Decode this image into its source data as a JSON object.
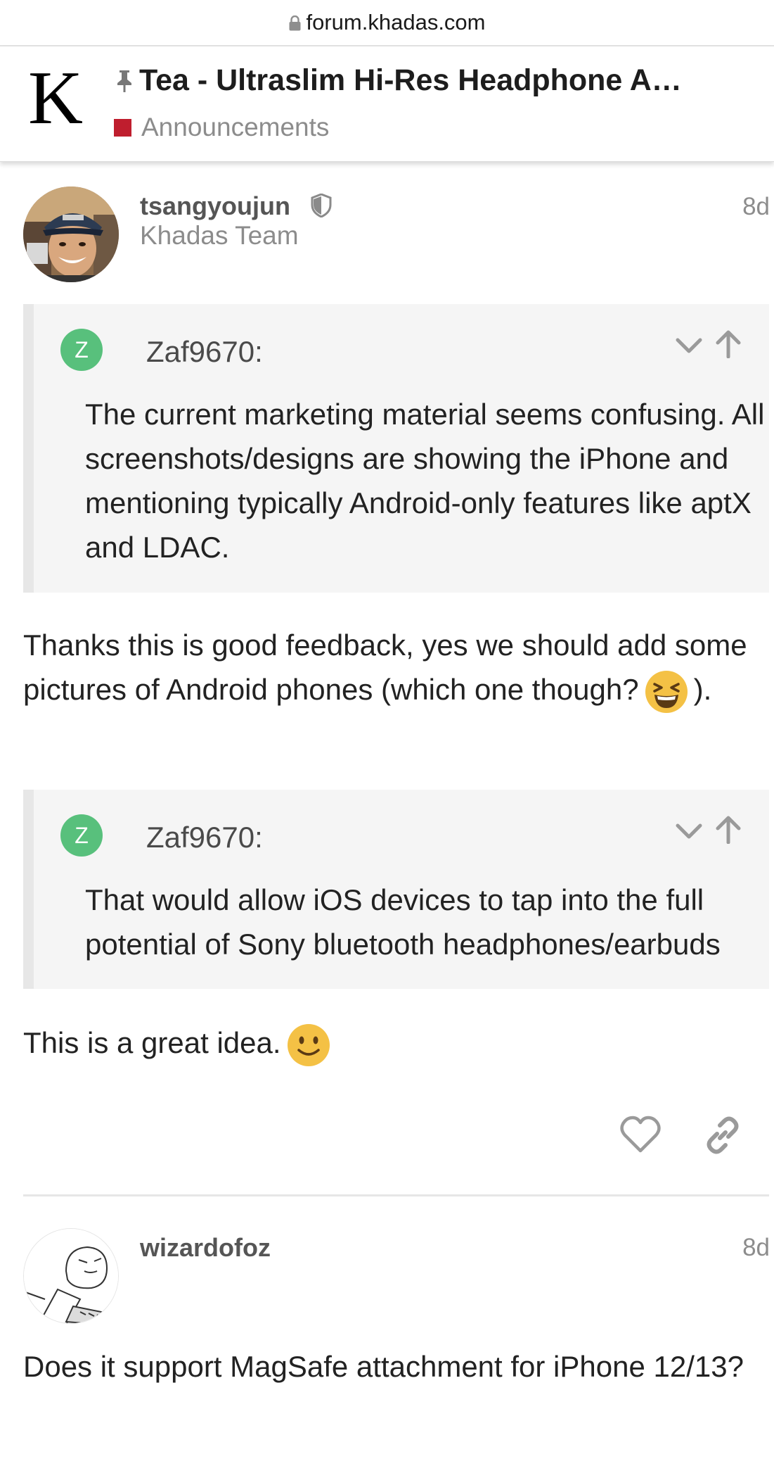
{
  "browser": {
    "url": "forum.khadas.com"
  },
  "header": {
    "logo_letter": "K",
    "title": "Tea - Ultraslim Hi-Res Headphone A…",
    "category": "Announcements",
    "category_color": "#bf1e2e"
  },
  "posts": [
    {
      "username": "tsangyoujun",
      "user_title": "Khadas Team",
      "date": "8d",
      "quote1": {
        "avatar_letter": "Z",
        "author": "Zaf9670:",
        "text": "The current marketing material seems confusing. All screenshots/designs are showing the iPhone and mentioning typically Android-only features like aptX and LDAC."
      },
      "reply1_text": "Thanks this is good feedback, yes we should add some pictures of Android phones (which one though?",
      "reply1_emoji": "laughing-emoji",
      "reply1_end": ").",
      "quote2": {
        "avatar_letter": "Z",
        "author": "Zaf9670:",
        "text": "That would allow iOS devices to tap into the full potential of Sony bluetooth headphones/earbuds"
      },
      "reply2_text": "This is a great idea.",
      "reply2_emoji": "slight-smile-emoji"
    },
    {
      "username": "wizardofoz",
      "date": "8d",
      "body": "Does it support MagSafe attachment for iPhone 12/13?"
    }
  ],
  "colors": {
    "quote_avatar": "#58c07c",
    "quote_bg": "#f5f5f5",
    "quote_border": "#e7e7e7"
  }
}
